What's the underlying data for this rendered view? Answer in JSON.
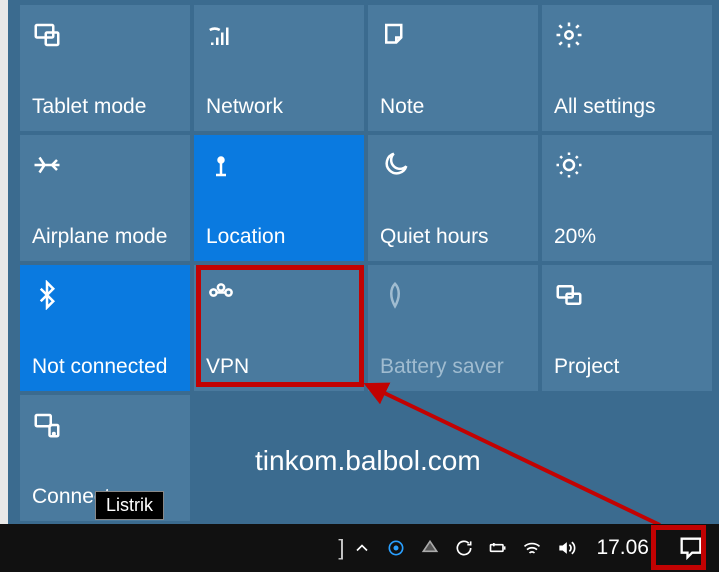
{
  "tiles": [
    {
      "label": "Tablet mode",
      "icon": "tablet-mode-icon",
      "active": false
    },
    {
      "label": "Network",
      "icon": "network-icon",
      "active": false
    },
    {
      "label": "Note",
      "icon": "note-icon",
      "active": false
    },
    {
      "label": "All settings",
      "icon": "gear-icon",
      "active": false
    },
    {
      "label": "Airplane mode",
      "icon": "airplane-icon",
      "active": false
    },
    {
      "label": "Location",
      "icon": "location-icon",
      "active": true
    },
    {
      "label": "Quiet hours",
      "icon": "moon-icon",
      "active": false
    },
    {
      "label": "20%",
      "icon": "brightness-icon",
      "active": false
    },
    {
      "label": "Not connected",
      "icon": "bluetooth-icon",
      "active": true
    },
    {
      "label": "VPN",
      "icon": "vpn-icon",
      "active": false
    },
    {
      "label": "Battery saver",
      "icon": "leaf-icon",
      "active": false,
      "disabled": true
    },
    {
      "label": "Project",
      "icon": "project-icon",
      "active": false
    },
    {
      "label": "Connect",
      "icon": "connect-icon",
      "active": false
    }
  ],
  "tooltip": "Listrik",
  "clock": "17.06",
  "watermark": "tinkom.balbol.com"
}
